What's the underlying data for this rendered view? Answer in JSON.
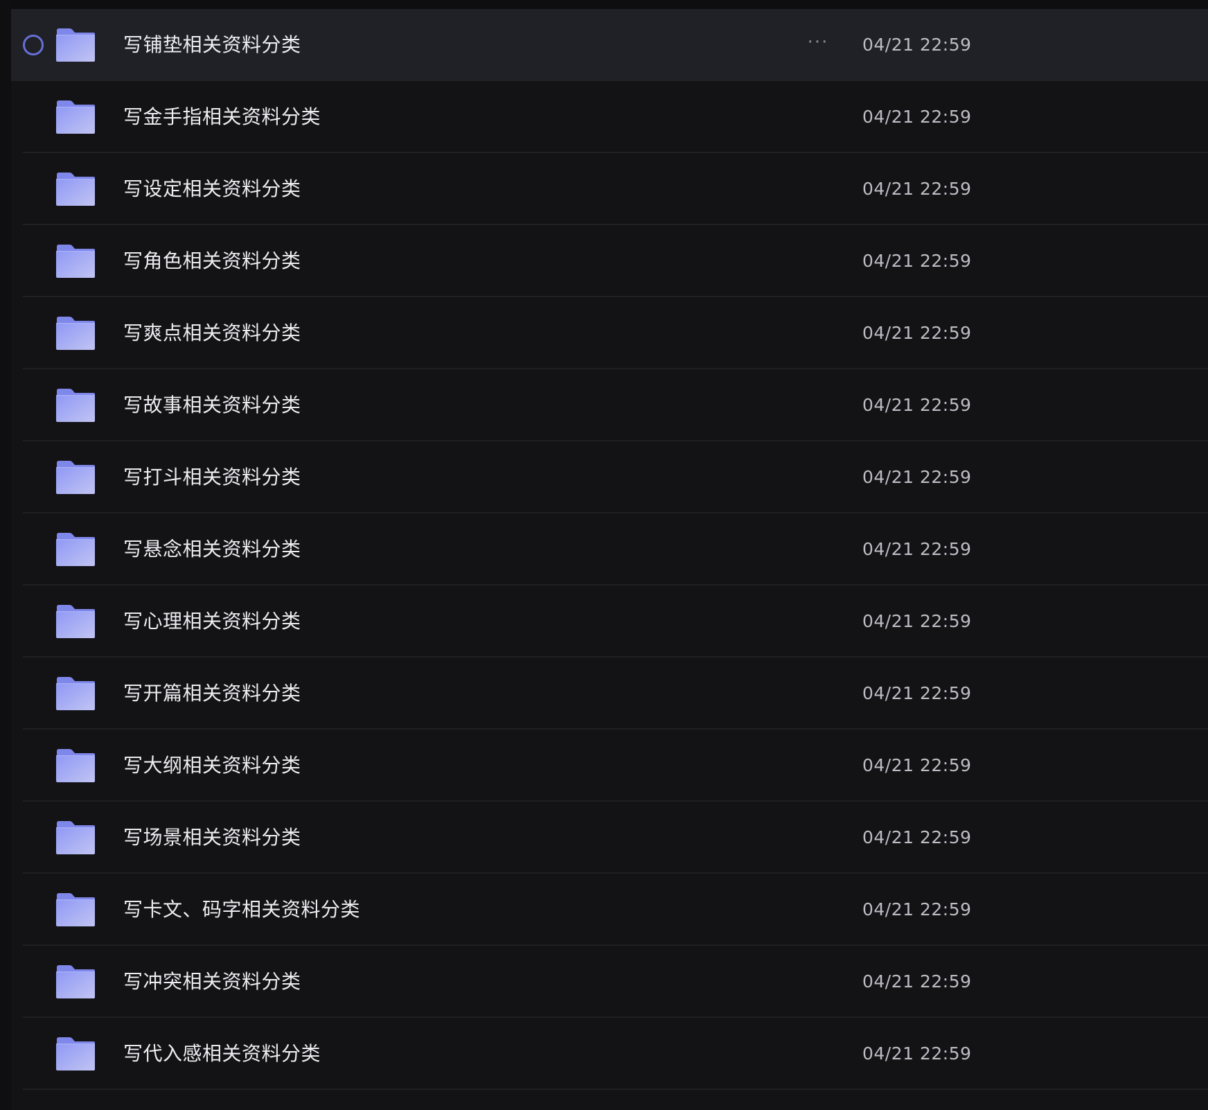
{
  "file_list": {
    "items": [
      {
        "name": "写铺垫相关资料分类",
        "date": "04/21 22:59",
        "icon": "folder-icon",
        "selected": true,
        "more_label": "···"
      },
      {
        "name": "写金手指相关资料分类",
        "date": "04/21 22:59",
        "icon": "folder-icon",
        "selected": false,
        "more_label": "···"
      },
      {
        "name": "写设定相关资料分类",
        "date": "04/21 22:59",
        "icon": "folder-icon",
        "selected": false,
        "more_label": "···"
      },
      {
        "name": "写角色相关资料分类",
        "date": "04/21 22:59",
        "icon": "folder-icon",
        "selected": false,
        "more_label": "···"
      },
      {
        "name": "写爽点相关资料分类",
        "date": "04/21 22:59",
        "icon": "folder-icon",
        "selected": false,
        "more_label": "···"
      },
      {
        "name": "写故事相关资料分类",
        "date": "04/21 22:59",
        "icon": "folder-icon",
        "selected": false,
        "more_label": "···"
      },
      {
        "name": "写打斗相关资料分类",
        "date": "04/21 22:59",
        "icon": "folder-icon",
        "selected": false,
        "more_label": "···"
      },
      {
        "name": "写悬念相关资料分类",
        "date": "04/21 22:59",
        "icon": "folder-icon",
        "selected": false,
        "more_label": "···"
      },
      {
        "name": "写心理相关资料分类",
        "date": "04/21 22:59",
        "icon": "folder-icon",
        "selected": false,
        "more_label": "···"
      },
      {
        "name": "写开篇相关资料分类",
        "date": "04/21 22:59",
        "icon": "folder-icon",
        "selected": false,
        "more_label": "···"
      },
      {
        "name": "写大纲相关资料分类",
        "date": "04/21 22:59",
        "icon": "folder-icon",
        "selected": false,
        "more_label": "···"
      },
      {
        "name": "写场景相关资料分类",
        "date": "04/21 22:59",
        "icon": "folder-icon",
        "selected": false,
        "more_label": "···"
      },
      {
        "name": "写卡文、码字相关资料分类",
        "date": "04/21 22:59",
        "icon": "folder-icon",
        "selected": false,
        "more_label": "···"
      },
      {
        "name": "写冲突相关资料分类",
        "date": "04/21 22:59",
        "icon": "folder-icon",
        "selected": false,
        "more_label": "···"
      },
      {
        "name": "写代入感相关资料分类",
        "date": "04/21 22:59",
        "icon": "folder-icon",
        "selected": false,
        "more_label": "···"
      }
    ]
  },
  "colors": {
    "background": "#131316",
    "selected_row": "#202027",
    "accent": "#6670d6",
    "folder_top": "#9aa3f7",
    "folder_bottom": "#b8bcf3",
    "text_primary": "#ececf1",
    "text_secondary": "#bdbdc5"
  }
}
